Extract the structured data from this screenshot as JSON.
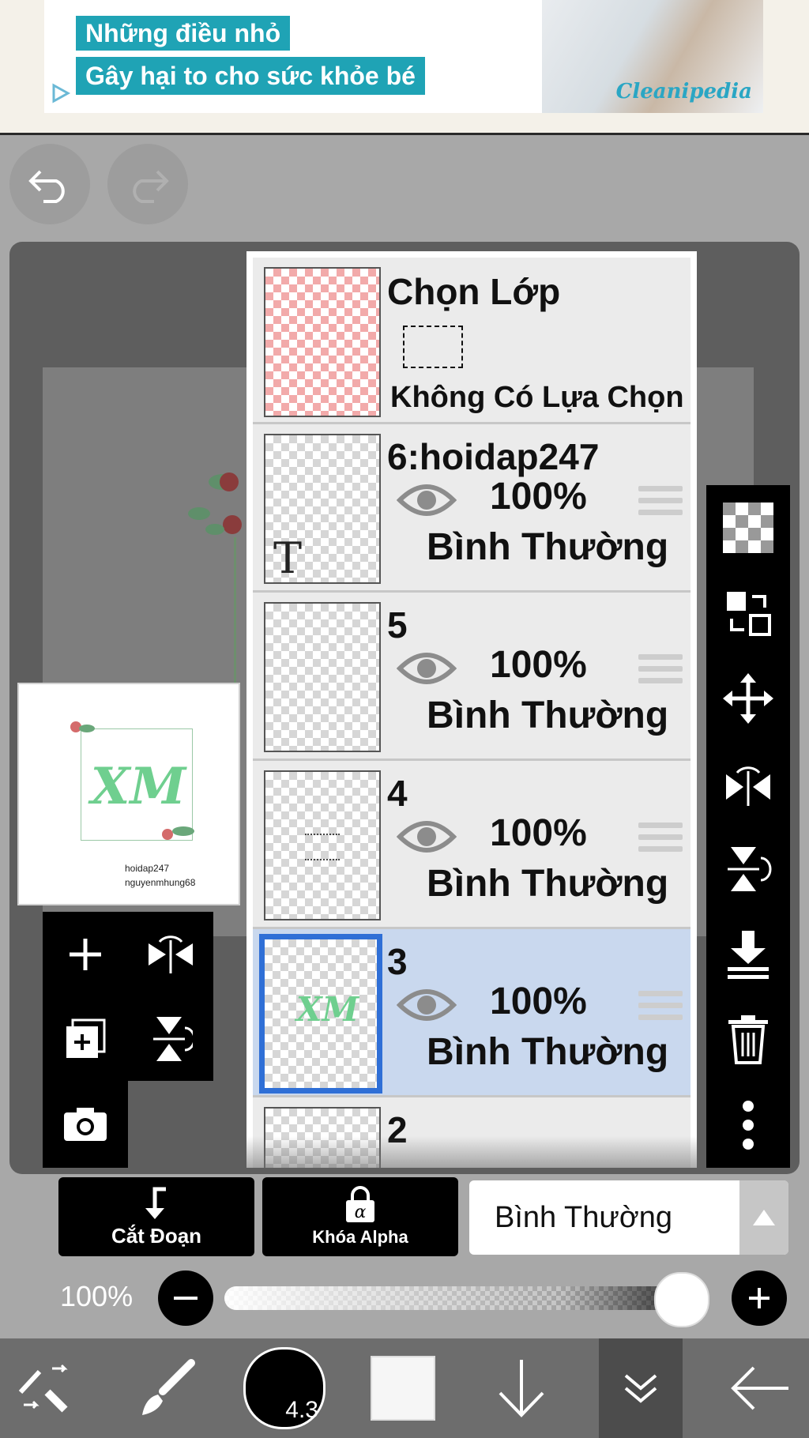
{
  "ad": {
    "line1": "Những điều nhỏ",
    "line2": "Gây hại to cho sức khỏe bé",
    "brand": "Cleanipedia"
  },
  "layers_panel": {
    "selection_layer": {
      "title": "Chọn Lớp",
      "subtitle": "Không Có Lựa Chọn"
    },
    "layers": [
      {
        "name": "6:hoidap247",
        "opacity": "100%",
        "blend": "Bình Thường"
      },
      {
        "name": "5",
        "opacity": "100%",
        "blend": "Bình Thường"
      },
      {
        "name": "4",
        "opacity": "100%",
        "blend": "Bình Thường"
      },
      {
        "name": "3",
        "opacity": "100%",
        "blend": "Bình Thường"
      },
      {
        "name": "2"
      }
    ]
  },
  "preview": {
    "caption1": "hoidap247",
    "caption2": "nguyenmhung68",
    "logo": "XM"
  },
  "controls": {
    "clipping_label": "Cắt Đoạn",
    "alpha_lock_label": "Khóa Alpha",
    "blend_mode": "Bình Thường",
    "opacity_label": "100%",
    "opacity_value": 1.0
  },
  "toolbar": {
    "brush_size": "4.3"
  },
  "colors": {
    "selected_highlight": "#c9d8ee",
    "selected_border": "#2f6fd6",
    "ad_teal": "#1fa3b5"
  }
}
